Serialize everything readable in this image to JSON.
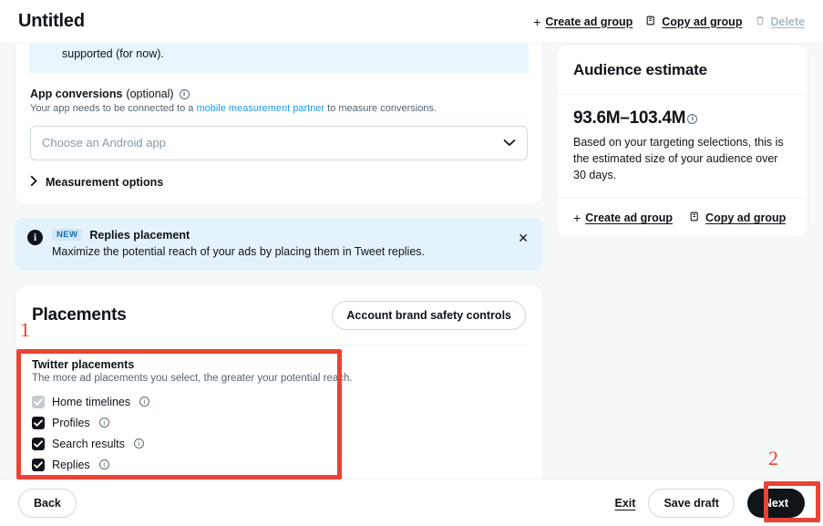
{
  "topbar": {
    "title": "Untitled",
    "actions": [
      {
        "icon": "plus-icon",
        "label": "Create ad group",
        "disabled": false
      },
      {
        "icon": "copy-icon",
        "label": "Copy ad group",
        "disabled": false
      },
      {
        "icon": "trash-icon",
        "label": "Delete",
        "disabled": true
      }
    ]
  },
  "app_conversions": {
    "info_box_text": "supported (for now).",
    "label": "App conversions",
    "label_optional": "(optional)",
    "description_before": "Your app needs to be connected to a ",
    "description_link": "mobile measurement partner",
    "description_after": " to measure conversions.",
    "select_placeholder": "Choose an Android app",
    "select_value": "",
    "measurement_options_label": "Measurement options"
  },
  "notice": {
    "badge": "NEW",
    "title": "Replies placement",
    "text": "Maximize the potential reach of your ads by placing them in Tweet replies.",
    "close_icon": "close-icon",
    "info_icon": "info-filled-icon"
  },
  "placements": {
    "title": "Placements",
    "brand_safety_button": "Account brand safety controls",
    "section_title": "Twitter placements",
    "section_desc": "The more ad placements you select, the greater your potential reach.",
    "options": [
      {
        "label": "Home timelines",
        "checked": true,
        "disabled": true
      },
      {
        "label": "Profiles",
        "checked": true,
        "disabled": false
      },
      {
        "label": "Search results",
        "checked": true,
        "disabled": false
      },
      {
        "label": "Replies",
        "checked": true,
        "disabled": false
      }
    ]
  },
  "audience": {
    "title": "Audience estimate",
    "estimate": "93.6M–103.4M",
    "description": "Based on your targeting selections, this is the estimated size of your audience over 30 days.",
    "actions": [
      {
        "icon": "plus-icon",
        "label": "Create ad group"
      },
      {
        "icon": "copy-icon",
        "label": "Copy ad group"
      }
    ]
  },
  "bottombar": {
    "back": "Back",
    "exit": "Exit",
    "save_draft": "Save draft",
    "next": "Next"
  },
  "annotations": {
    "marker_1": "1",
    "marker_2": "2",
    "color": "#ea4335"
  }
}
